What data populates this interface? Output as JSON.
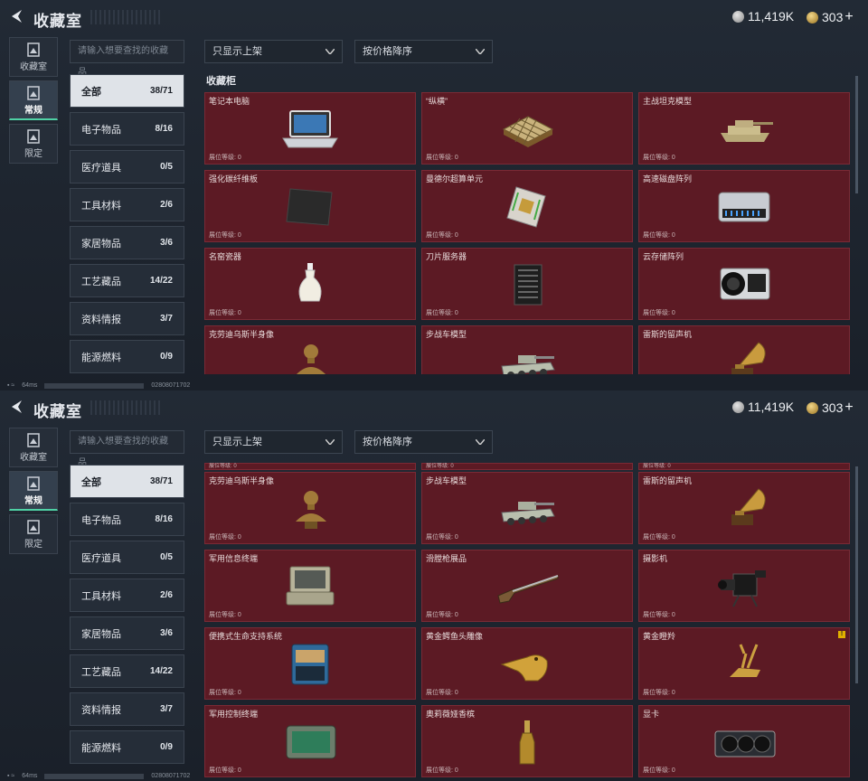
{
  "header": {
    "title": "收藏室",
    "currency_silver": "11,419K",
    "currency_gold": "303",
    "plus": "+"
  },
  "sidebar": {
    "items": [
      {
        "label": "收藏室"
      },
      {
        "label": "常规"
      },
      {
        "label": "限定"
      }
    ]
  },
  "search": {
    "placeholder": "请输入想要查找的收藏品"
  },
  "filters": {
    "show": "只显示上架",
    "sort": "按价格降序"
  },
  "categories": [
    {
      "label": "全部",
      "count": "38/71"
    },
    {
      "label": "电子物品",
      "count": "8/16"
    },
    {
      "label": "医疗道具",
      "count": "0/5"
    },
    {
      "label": "工具材料",
      "count": "2/6"
    },
    {
      "label": "家居物品",
      "count": "3/6"
    },
    {
      "label": "工艺藏品",
      "count": "14/22"
    },
    {
      "label": "资料情报",
      "count": "3/7"
    },
    {
      "label": "能源燃料",
      "count": "0/9"
    }
  ],
  "cabinet_label": "收藏柜",
  "level_text": "展位等级: 0",
  "items_top": [
    {
      "name": "笔记本电脑",
      "icon": "laptop-icon"
    },
    {
      "name": "“纵横”",
      "icon": "chessboard-icon"
    },
    {
      "name": "主战坦克模型",
      "icon": "tank-icon"
    },
    {
      "name": "强化碳纤维板",
      "icon": "carbon-plate-icon"
    },
    {
      "name": "曼德尔超算单元",
      "icon": "circuit-board-icon"
    },
    {
      "name": "高速磁盘阵列",
      "icon": "disk-array-icon"
    },
    {
      "name": "名窑瓷器",
      "icon": "vase-icon"
    },
    {
      "name": "刀片服务器",
      "icon": "server-icon"
    },
    {
      "name": "云存储阵列",
      "icon": "storage-array-icon"
    },
    {
      "name": "克劳迪乌斯半身像",
      "icon": "bust-icon"
    },
    {
      "name": "步战车模型",
      "icon": "ifv-icon"
    },
    {
      "name": "雷斯的留声机",
      "icon": "gramophone-icon"
    }
  ],
  "items_bottom": [
    {
      "name": "克劳迪乌斯半身像",
      "icon": "bust-icon"
    },
    {
      "name": "步战车模型",
      "icon": "ifv-icon"
    },
    {
      "name": "雷斯的留声机",
      "icon": "gramophone-icon"
    },
    {
      "name": "军用信息终端",
      "icon": "terminal-case-icon"
    },
    {
      "name": "滑膛枪展品",
      "icon": "musket-icon"
    },
    {
      "name": "摄影机",
      "icon": "camera-icon"
    },
    {
      "name": "便携式生命支持系统",
      "icon": "life-support-icon"
    },
    {
      "name": "黄金鳄鱼头雕像",
      "icon": "gold-croc-icon"
    },
    {
      "name": "黄金瞪羚",
      "icon": "gold-gazelle-icon",
      "badge": "!"
    },
    {
      "name": "军用控制终端",
      "icon": "control-terminal-icon"
    },
    {
      "name": "奥莉薇娅香槟",
      "icon": "champagne-icon"
    },
    {
      "name": "显卡",
      "icon": "gpu-icon"
    }
  ],
  "status": {
    "ping": "64ms",
    "code": "02808071702"
  },
  "colors": {
    "card_bg": "#5c1a24",
    "active_tab": "#4fd1a5"
  }
}
